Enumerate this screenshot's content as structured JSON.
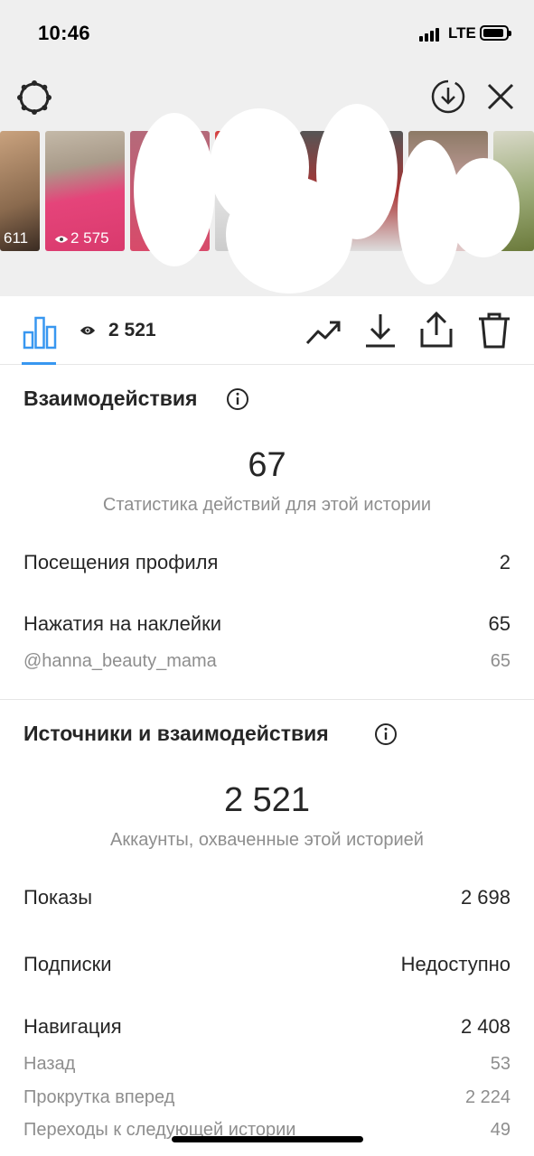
{
  "status_bar": {
    "time": "10:46",
    "network": "LTE"
  },
  "header": {
    "settings_icon": "settings-icon",
    "download_icon": "download-circle-icon",
    "close_icon": "close-icon"
  },
  "stories": {
    "thumbnails": [
      {
        "count": "611"
      },
      {
        "count": "2 575"
      }
    ]
  },
  "toolbar": {
    "views": "2 521",
    "icons": [
      "insights-icon",
      "eye-icon",
      "trend-icon",
      "save-icon",
      "share-icon",
      "delete-icon"
    ],
    "accent_color": "#3897f0"
  },
  "interactions": {
    "title": "Взаимодействия",
    "total": "67",
    "caption": "Статистика действий для этой истории",
    "rows": [
      {
        "label": "Посещения профиля",
        "value": "2"
      },
      {
        "label": "Нажатия на наклейки",
        "value": "65"
      }
    ],
    "sub_rows": [
      {
        "label": "@hanna_beauty_mama",
        "value": "65"
      }
    ]
  },
  "discovery": {
    "title": "Источники и взаимодействия",
    "total": "2 521",
    "caption": "Аккаунты, охваченные этой историей",
    "rows": [
      {
        "label": "Показы",
        "value": "2 698"
      },
      {
        "label": "Подписки",
        "value": "Недоступно"
      },
      {
        "label": "Навигация",
        "value": "2 408"
      }
    ],
    "sub_rows": [
      {
        "label": "Назад",
        "value": "53"
      },
      {
        "label": "Прокрутка вперед",
        "value": "2 224"
      },
      {
        "label": "Переходы к следующей истории",
        "value": "49"
      }
    ]
  },
  "colors": {
    "text": "#262626",
    "secondary_text": "#8e8e8e",
    "divider": "#e6e6e6"
  }
}
